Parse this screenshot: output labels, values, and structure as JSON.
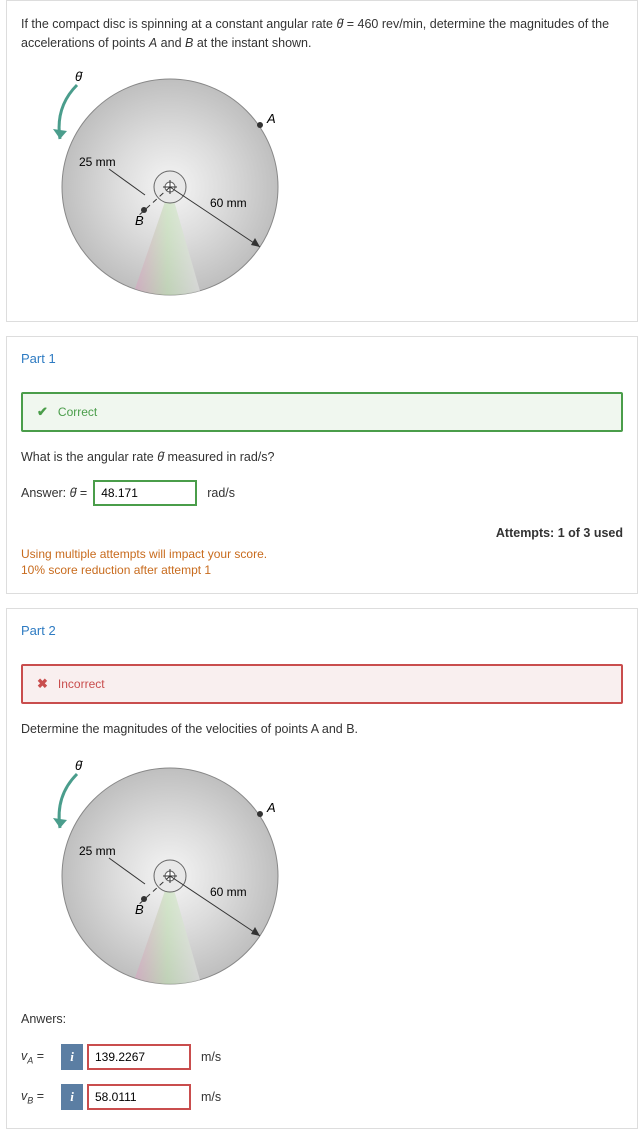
{
  "problem": {
    "text_before_theta": "If the compact disc is spinning at a constant angular rate ",
    "theta_sym": "θ̇",
    "text_mid": " = 460 rev/min, determine the magnitudes of the accelerations of points ",
    "text_tail": " at the instant shown.",
    "A": "A",
    "and": " and ",
    "B": "B"
  },
  "disc": {
    "label_theta": "θ̇",
    "point_A": "A",
    "point_B": "B",
    "r_inner": "25 mm",
    "r_outer": "60 mm"
  },
  "part1": {
    "header": "Part 1",
    "status": "Correct",
    "question_pre": "What is the angular rate ",
    "question_theta": "θ̇",
    "question_post": " measured in rad/s?",
    "answer_label_pre": "Answer: ",
    "answer_theta": "θ̇",
    "equals": " = ",
    "value": "48.171",
    "unit": "rad/s",
    "attempts": "Attempts: 1 of 3 used",
    "warn1": "Using multiple attempts will impact your score.",
    "warn2": "10% score reduction after attempt 1"
  },
  "part2": {
    "header": "Part 2",
    "status": "Incorrect",
    "question": "Determine the magnitudes of the velocities of points A and B.",
    "answers_label": "Anwers:",
    "info": "i",
    "rowA": {
      "var": "v",
      "sub": "A",
      "eq": " = ",
      "value": "139.2267",
      "unit": "m/s"
    },
    "rowB": {
      "var": "v",
      "sub": "B",
      "eq": " = ",
      "value": "58.0111",
      "unit": "m/s"
    }
  },
  "chart_data": {
    "type": "diagram",
    "object": "compact disc",
    "angular_rate_rev_per_min": 460,
    "points": [
      {
        "name": "A",
        "radius_mm": 60
      },
      {
        "name": "B",
        "radius_mm": 25
      }
    ]
  }
}
